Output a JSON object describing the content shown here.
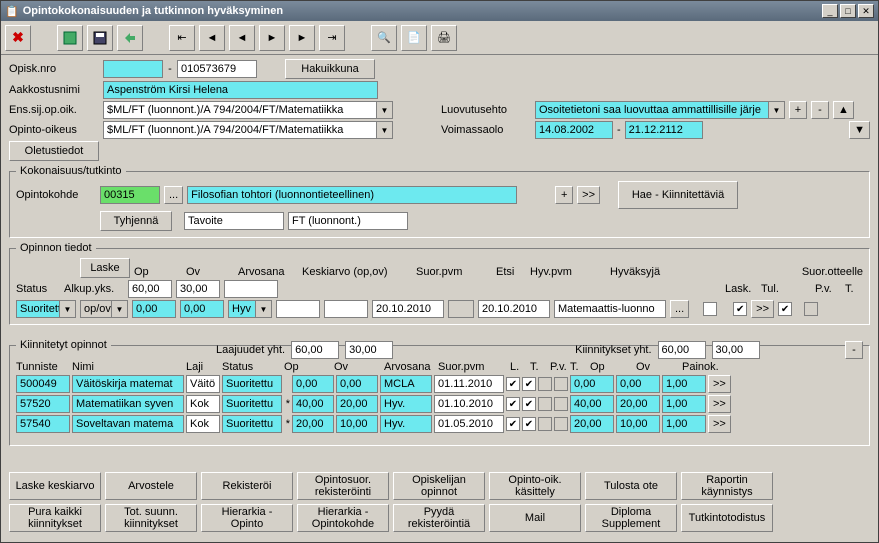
{
  "window": {
    "title": "Opintokokonaisuuden ja tutkinnon hyväksyminen"
  },
  "header": {
    "opisk_nro_label": "Opisk.nro",
    "opisk_nro_value": "010573679",
    "hakuikkuna": "Hakuikkuna",
    "aakkostusnimi_label": "Aakkostusnimi",
    "aakkostusnimi_value": "Aspenström Kirsi Helena",
    "ens_label": "Ens.sij.op.oik.",
    "ens_value": "$ML/FT (luonnont.)/A 794/2004/FT/Matematiikka",
    "opinto_label": "Opinto-oikeus",
    "opinto_value": "$ML/FT (luonnont.)/A 794/2004/FT/Matematiikka",
    "oletustiedot": "Oletustiedot",
    "luovutusehto_label": "Luovutusehto",
    "luovutusehto_value": "Osoitetietoni saa luovuttaa ammattillisille järje",
    "voimassaolo_label": "Voimassaolo",
    "voimassaolo_from": "14.08.2002",
    "voimassaolo_to": "21.12.2112",
    "plus": "+",
    "minus": "-"
  },
  "kokonaisuus": {
    "legend": "Kokonaisuus/tutkinto",
    "opintokohde_label": "Opintokohde",
    "opintokohde_code": "00315",
    "dots": "...",
    "desc": "Filosofian tohtori  (luonnontieteellinen)",
    "plus": "+",
    "next": ">>",
    "hae": "Hae - Kiinnitettäviä",
    "tyhjenna": "Tyhjennä",
    "tavoite": "Tavoite",
    "ft": "FT (luonnont.)"
  },
  "opinnon": {
    "legend": "Opinnon tiedot",
    "status_label": "Status",
    "laske": "Laske",
    "op_label": "Op",
    "ov_label": "Ov",
    "arvosana_label": "Arvosana",
    "keskiarvo_label": "Keskiarvo (op,ov)",
    "alkupyks": "Alkup.yks.",
    "op_val": "60,00",
    "ov_val": "30,00",
    "status_val": "Suoritettu",
    "opov": "op/ov",
    "op2": "0,00",
    "ov2": "0,00",
    "hyv": "Hyv",
    "suorpvm_label": "Suor.pvm",
    "etsi_label": "Etsi",
    "hyvpvm_label": "Hyv.pvm",
    "hyvaksyja_label": "Hyväksyjä",
    "suorpvm": "20.10.2010",
    "hyvpvm": "20.10.2010",
    "hyvaksyja": "Matemaattis-luonno",
    "suorotteelle": "Suor.otteelle",
    "lask": "Lask.",
    "tul": "Tul.",
    "pv": "P.v.",
    "t": "T.",
    "next": ">>",
    "dots": "..."
  },
  "kiinnitetyt": {
    "legend": "Kiinnitetyt opinnot",
    "laajuudet": "Laajuudet yht.",
    "laaj_op": "60,00",
    "laaj_ov": "30,00",
    "kiinn": "Kiinnitykset yht.",
    "kiinn_op": "60,00",
    "kiinn_ov": "30,00",
    "cols": {
      "tunniste": "Tunniste",
      "nimi": "Nimi",
      "laji": "Laji",
      "status": "Status",
      "op": "Op",
      "ov": "Ov",
      "arvosana": "Arvosana",
      "suorpvm": "Suor.pvm",
      "l": "L.",
      "t": "T.",
      "pv": "P.v.",
      "t2": "T.",
      "op2": "Op",
      "ov2": "Ov",
      "painok": "Painok."
    },
    "rows": [
      {
        "tunniste": "500049",
        "nimi": "Väitöskirja matemat",
        "laji": "Väitö",
        "status": "Suoritettu",
        "star": "",
        "op": "0,00",
        "ov": "0,00",
        "arvosana": "MCLA",
        "suorpvm": "01.11.2010",
        "l": true,
        "t": true,
        "pv": false,
        "t2": false,
        "op2": "0,00",
        "ov2": "0,00",
        "painok": "1,00"
      },
      {
        "tunniste": "57520",
        "nimi": "Matematiikan syven",
        "laji": "Kok",
        "status": "Suoritettu",
        "star": "*",
        "op": "40,00",
        "ov": "20,00",
        "arvosana": "Hyv.",
        "suorpvm": "01.10.2010",
        "l": true,
        "t": true,
        "pv": false,
        "t2": false,
        "op2": "40,00",
        "ov2": "20,00",
        "painok": "1,00"
      },
      {
        "tunniste": "57540",
        "nimi": "Soveltavan matema",
        "laji": "Kok",
        "status": "Suoritettu",
        "star": "*",
        "op": "20,00",
        "ov": "10,00",
        "arvosana": "Hyv.",
        "suorpvm": "01.05.2010",
        "l": true,
        "t": true,
        "pv": false,
        "t2": false,
        "op2": "20,00",
        "ov2": "10,00",
        "painok": "1,00"
      }
    ],
    "next": ">>",
    "minus": "-"
  },
  "buttons": {
    "r1": [
      "Laske keskiarvo",
      "Arvostele",
      "Rekisteröi",
      "Opintosuor. rekisteröinti",
      "Opiskelijan opinnot",
      "Opinto-oik. käsittely",
      "Tulosta ote",
      "Raportin käynnistys"
    ],
    "r2": [
      "Pura kaikki kiinnitykset",
      "Tot. suunn. kiinnitykset",
      "Hierarkia - Opinto",
      "Hierarkia - Opintokohde",
      "Pyydä rekisteröintiä",
      "Mail",
      "Diploma Supplement",
      "Tutkintotodistus"
    ]
  }
}
